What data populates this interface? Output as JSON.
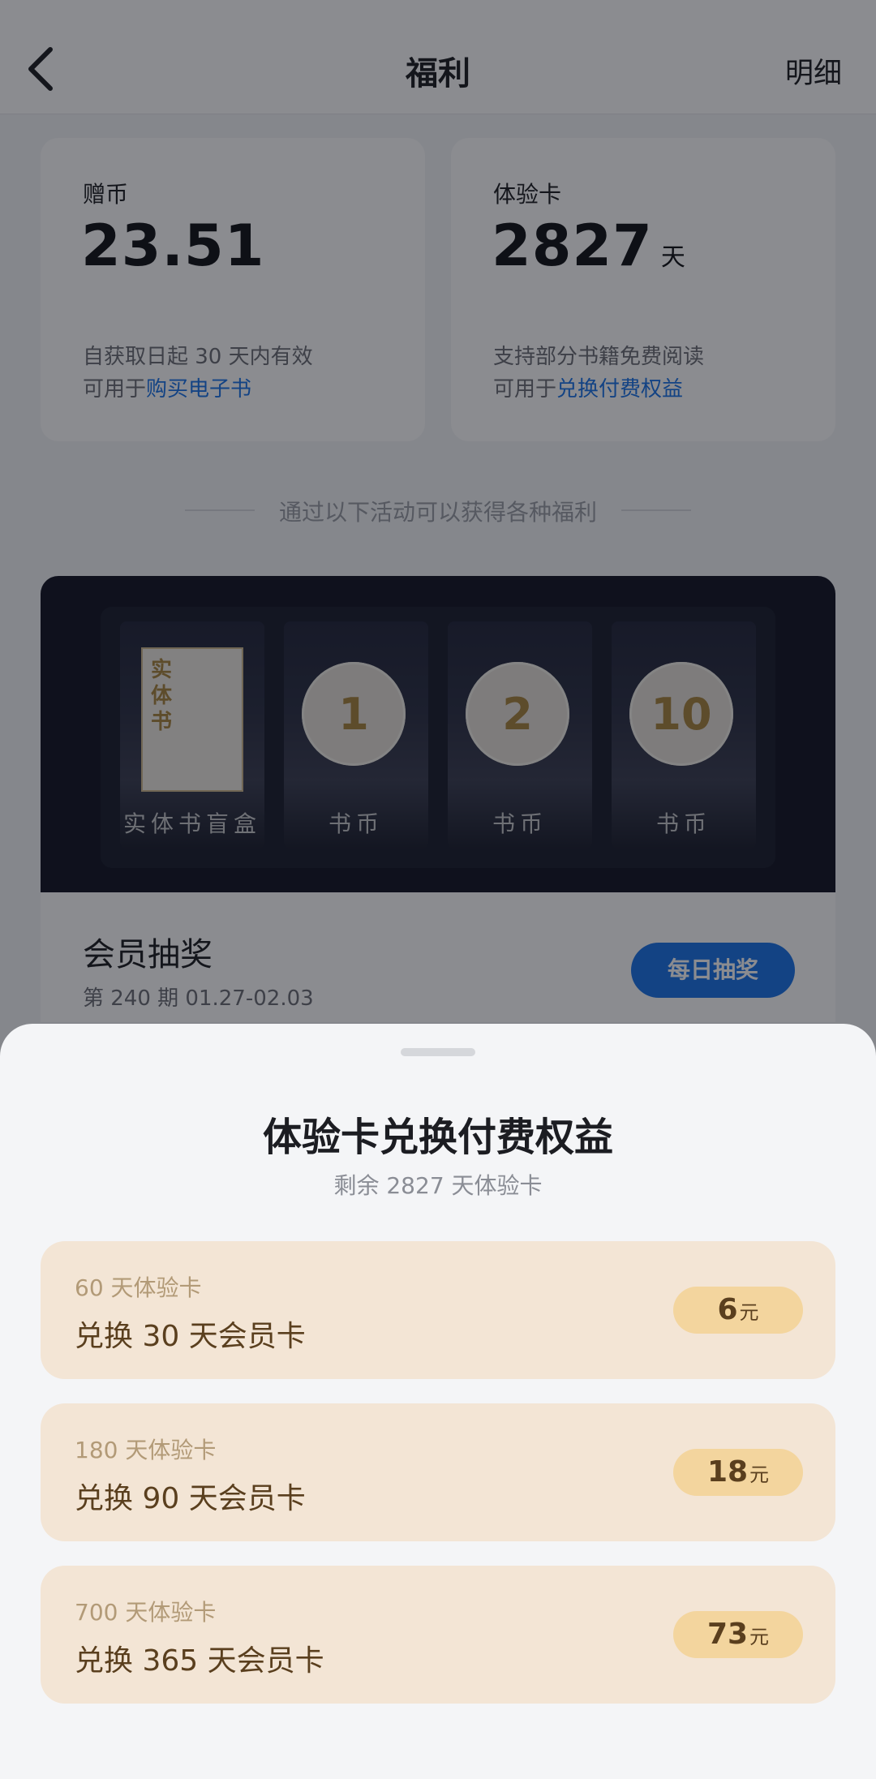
{
  "header": {
    "title": "福利",
    "detail_label": "明细"
  },
  "cards": [
    {
      "label": "赠币",
      "value": "23.51",
      "unit": "",
      "desc_line1": "自获取日起 30 天内有效",
      "desc_prefix": "可用于",
      "desc_link": "购买电子书"
    },
    {
      "label": "体验卡",
      "value": "2827",
      "unit": "天",
      "desc_line1": "支持部分书籍免费阅读",
      "desc_prefix": "可用于",
      "desc_link": "兑换付费权益"
    }
  ],
  "divider_text": "通过以下活动可以获得各种福利",
  "lottery": {
    "slots": [
      {
        "type": "book",
        "book_text": "实体书",
        "label": "实体书盲盒"
      },
      {
        "type": "coin",
        "number": "1",
        "label": "书币"
      },
      {
        "type": "coin",
        "number": "2",
        "label": "书币"
      },
      {
        "type": "coin",
        "number": "10",
        "label": "书币"
      }
    ],
    "title": "会员抽奖",
    "subtitle": "第 240 期  01.27-02.03",
    "button_label": "每日抽奖"
  },
  "sheet": {
    "title": "体验卡兑换付费权益",
    "subtitle": "剩余 2827 天体验卡",
    "options": [
      {
        "small": "60 天体验卡",
        "big": "兑换 30 天会员卡",
        "price": "6",
        "price_unit": "元"
      },
      {
        "small": "180 天体验卡",
        "big": "兑换 90 天会员卡",
        "price": "18",
        "price_unit": "元"
      },
      {
        "small": "700 天体验卡",
        "big": "兑换 365 天会员卡",
        "price": "73",
        "price_unit": "元"
      }
    ]
  },
  "colors": {
    "accent_blue": "#1a73e8",
    "option_bg": "#f3e5d5",
    "price_bg": "#f3d59e",
    "gold": "#a8843f"
  }
}
